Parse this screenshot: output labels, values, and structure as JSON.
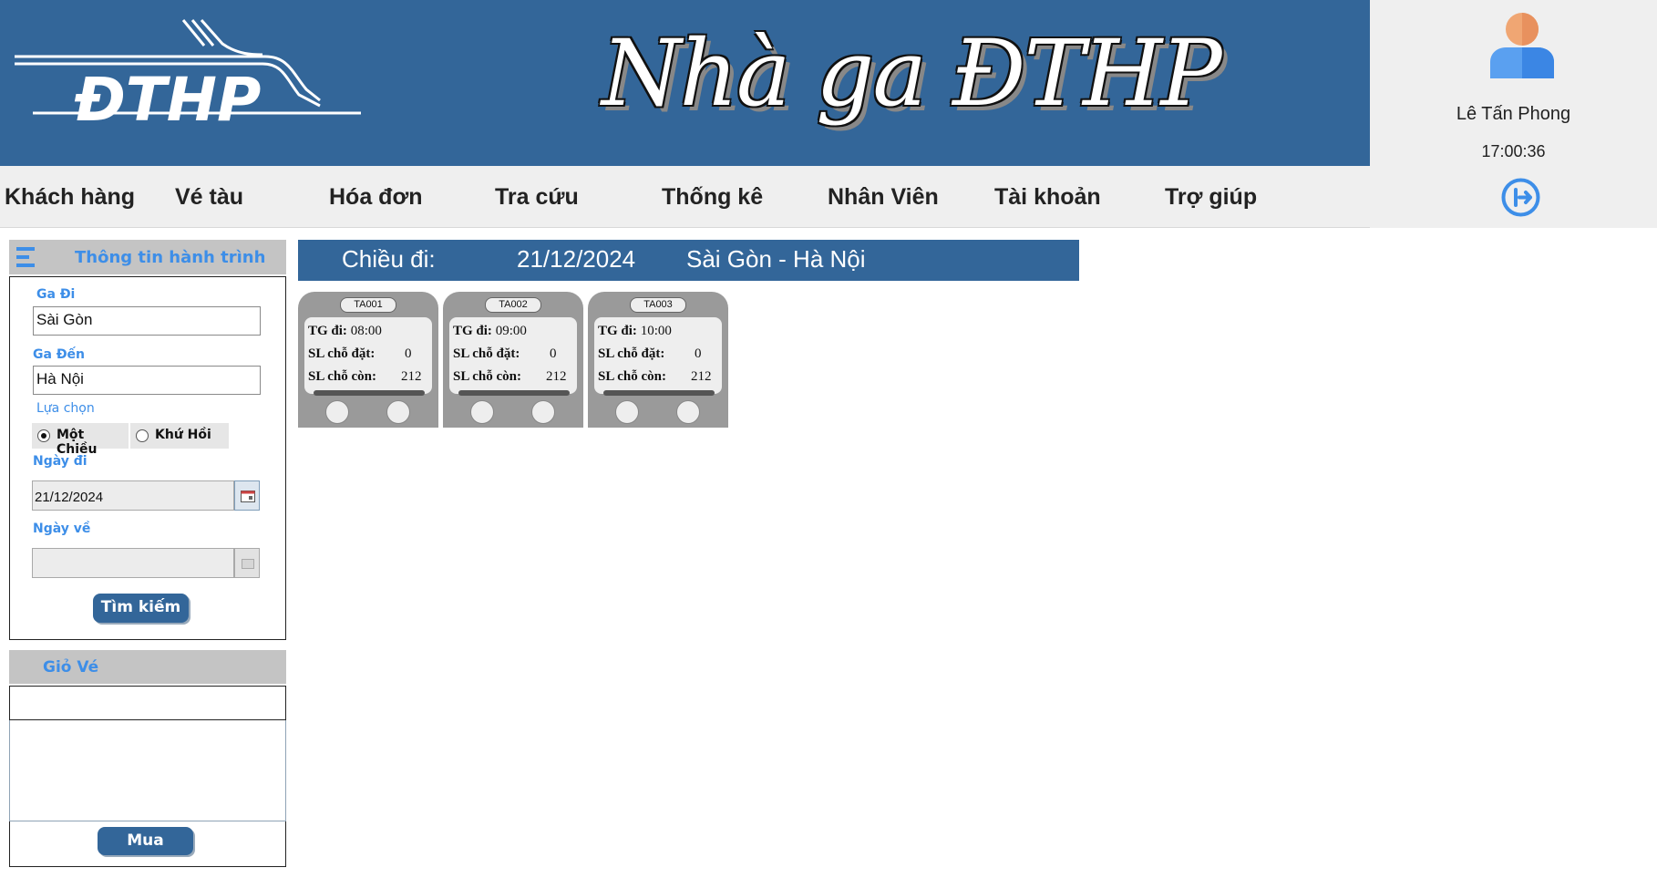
{
  "banner": {
    "logo_text": "ĐTHP",
    "title": "Nhà ga ĐTHP"
  },
  "user": {
    "name": "Lê Tấn Phong",
    "clock": "17:00:36"
  },
  "menu": [
    "Khách hàng",
    "Vé tàu",
    "Hóa đơn",
    "Tra cứu",
    "Thống kê",
    "Nhân Viên",
    "Tài khoản",
    "Trợ giúp"
  ],
  "trip": {
    "title": "Thông tin hành trình",
    "from_label": "Ga Đi",
    "from_value": "Sài Gòn",
    "to_label": "Ga Đến",
    "to_value": "Hà Nội",
    "option_label": "Lựa chọn",
    "options": [
      "Một Chiều",
      "Khứ Hồi"
    ],
    "selected_option": "Một Chiều",
    "depart_label": "Ngày đi",
    "depart_value": "21/12/2024",
    "return_label": "Ngày về",
    "return_value": "",
    "search_button": "Tìm kiếm"
  },
  "cart": {
    "title": "Giỏ Vé",
    "buy_button": "Mua"
  },
  "journey": {
    "label": "Chiều đi:",
    "date": "21/12/2024",
    "route": "Sài Gòn - Hà Nội"
  },
  "trains": [
    {
      "code": "TA001",
      "time_label": "TG đi:",
      "time": "08:00",
      "booked_label": "SL chỗ đặt:",
      "booked": "0",
      "left_label": "SL chỗ còn:",
      "left": "212"
    },
    {
      "code": "TA002",
      "time_label": "TG đi:",
      "time": "09:00",
      "booked_label": "SL chỗ đặt:",
      "booked": "0",
      "left_label": "SL chỗ còn:",
      "left": "212"
    },
    {
      "code": "TA003",
      "time_label": "TG đi:",
      "time": "10:00",
      "booked_label": "SL chỗ đặt:",
      "booked": "0",
      "left_label": "SL chỗ còn:",
      "left": "212"
    }
  ],
  "colors": {
    "brand": "#336699",
    "accent": "#3d8ee8",
    "panel": "#efefef",
    "header_gray": "#c4c4c4",
    "card_gray": "#9a9a9a"
  },
  "icons": {
    "menu": "hamburger-icon",
    "user": "user-avatar-icon",
    "logout": "logout-icon",
    "calendar": "calendar-icon"
  }
}
